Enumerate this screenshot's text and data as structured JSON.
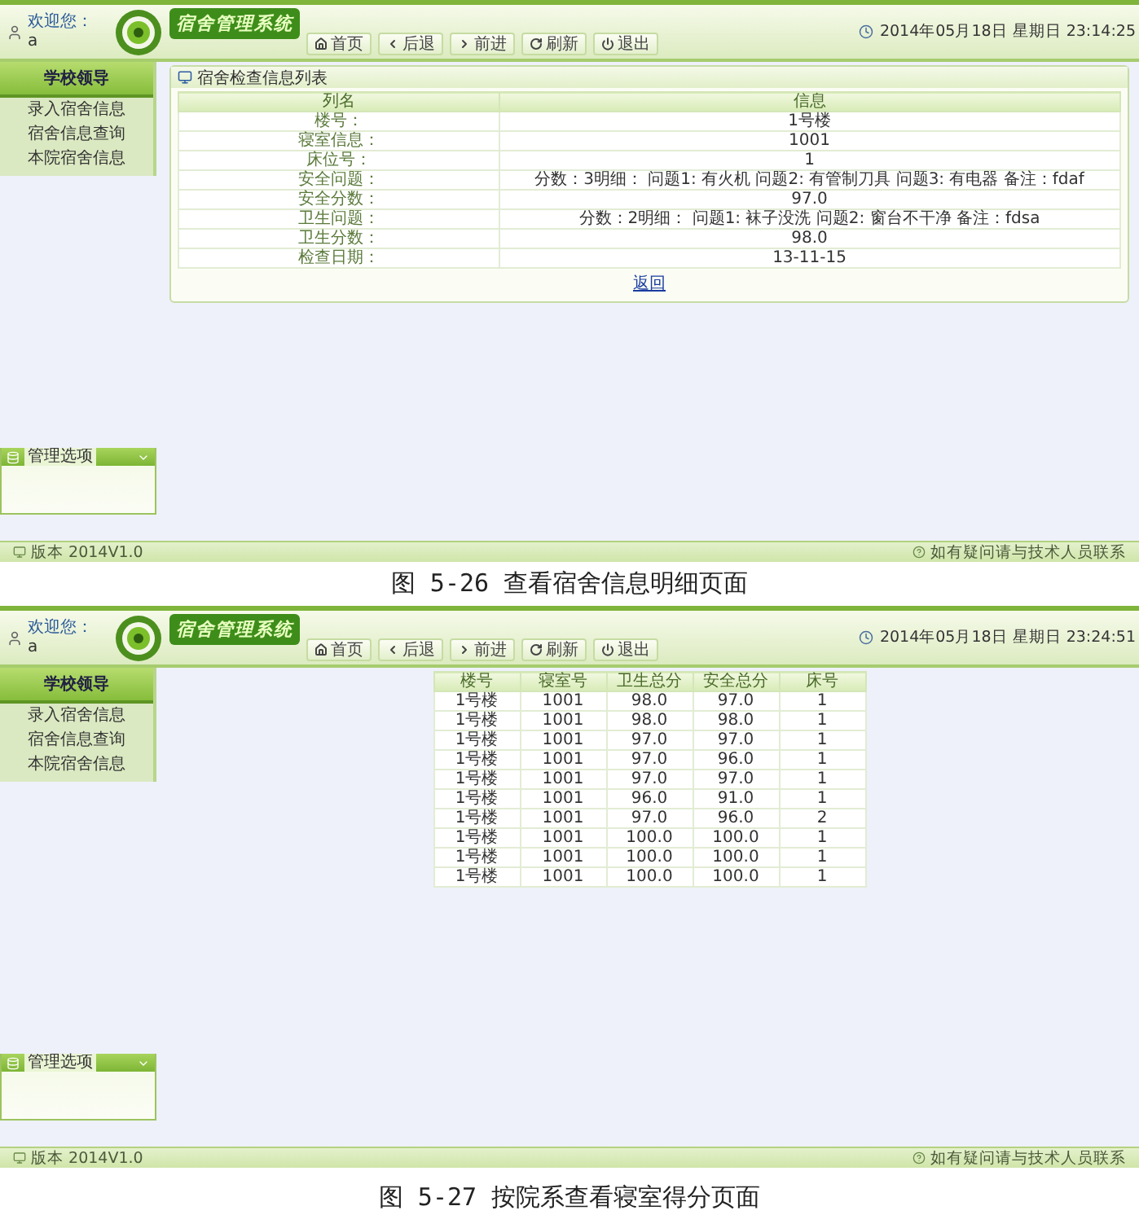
{
  "screens": [
    {
      "header": {
        "welcome": "欢迎您：",
        "user": "a",
        "app_title": "宿舍管理系统",
        "nav": [
          {
            "kind": "home",
            "label": "首页"
          },
          {
            "kind": "back",
            "label": "后退"
          },
          {
            "kind": "forward",
            "label": "前进"
          },
          {
            "kind": "refresh",
            "label": "刷新"
          },
          {
            "kind": "exit",
            "label": "退出"
          }
        ],
        "datetime": "2014年05月18日 星期日 23:14:25"
      },
      "sidebar": {
        "title": "学校领导",
        "items": [
          "录入宿舍信息",
          "宿舍信息查询",
          "本院宿舍信息"
        ],
        "panel_title": "管理选项"
      },
      "content": {
        "kind": "detail",
        "title": "宿舍检查信息列表",
        "columns": [
          "列名",
          "信息"
        ],
        "rows": [
          [
            "楼号：",
            "1号楼"
          ],
          [
            "寝室信息：",
            "1001"
          ],
          [
            "床位号：",
            "1"
          ],
          [
            "安全问题：",
            "分数：3明细： 问题1: 有火机 问题2: 有管制刀具 问题3: 有电器 备注：fdaf"
          ],
          [
            "安全分数：",
            "97.0"
          ],
          [
            "卫生问题：",
            "分数：2明细： 问题1: 袜子没洗 问题2: 窗台不干净 备注：fdsa"
          ],
          [
            "卫生分数：",
            "98.0"
          ],
          [
            "检查日期：",
            "13-11-15"
          ]
        ],
        "link": "返回"
      },
      "footer": {
        "version": "版本 2014V1.0",
        "note": "如有疑问请与技术人员联系"
      },
      "caption": "图 5-26 查看宿舍信息明细页面"
    },
    {
      "header": {
        "welcome": "欢迎您：",
        "user": "a",
        "app_title": "宿舍管理系统",
        "nav": [
          {
            "kind": "home",
            "label": "首页"
          },
          {
            "kind": "back",
            "label": "后退"
          },
          {
            "kind": "forward",
            "label": "前进"
          },
          {
            "kind": "refresh",
            "label": "刷新"
          },
          {
            "kind": "exit",
            "label": "退出"
          }
        ],
        "datetime": "2014年05月18日 星期日 23:24:51"
      },
      "sidebar": {
        "title": "学校领导",
        "items": [
          "录入宿舍信息",
          "宿舍信息查询",
          "本院宿舍信息"
        ],
        "panel_title": "管理选项"
      },
      "content": {
        "kind": "table",
        "columns": [
          "楼号",
          "寝室号",
          "卫生总分",
          "安全总分",
          "床号"
        ],
        "rows": [
          [
            "1号楼",
            "1001",
            "98.0",
            "97.0",
            "1"
          ],
          [
            "1号楼",
            "1001",
            "98.0",
            "98.0",
            "1"
          ],
          [
            "1号楼",
            "1001",
            "97.0",
            "97.0",
            "1"
          ],
          [
            "1号楼",
            "1001",
            "97.0",
            "96.0",
            "1"
          ],
          [
            "1号楼",
            "1001",
            "97.0",
            "97.0",
            "1"
          ],
          [
            "1号楼",
            "1001",
            "96.0",
            "91.0",
            "1"
          ],
          [
            "1号楼",
            "1001",
            "97.0",
            "96.0",
            "2"
          ],
          [
            "1号楼",
            "1001",
            "100.0",
            "100.0",
            "1"
          ],
          [
            "1号楼",
            "1001",
            "100.0",
            "100.0",
            "1"
          ],
          [
            "1号楼",
            "1001",
            "100.0",
            "100.0",
            "1"
          ]
        ]
      },
      "footer": {
        "version": "版本 2014V1.0",
        "note": "如有疑问请与技术人员联系"
      },
      "caption": "图 5-27 按院系查看寝室得分页面"
    }
  ]
}
